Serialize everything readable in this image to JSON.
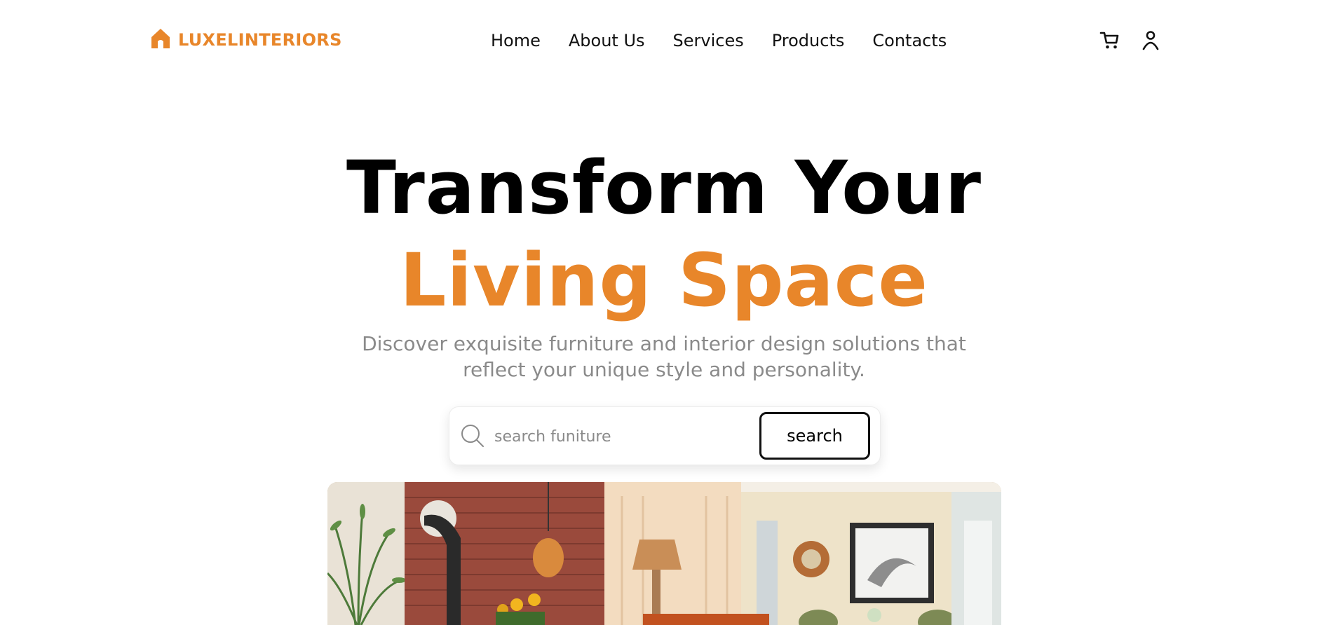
{
  "brand": {
    "name": "LUXELINTERIORS",
    "icon": "house-icon",
    "color": "#e8862a"
  },
  "nav": {
    "items": [
      {
        "label": "Home"
      },
      {
        "label": "About Us"
      },
      {
        "label": "Services"
      },
      {
        "label": "Products"
      },
      {
        "label": "Contacts"
      }
    ],
    "icons": [
      "cart-icon",
      "user-icon"
    ]
  },
  "hero": {
    "title_line1": "Transform Your",
    "title_line2": "Living Space",
    "subtitle": "Discover exquisite furniture and interior design solutions that reflect your unique style and personality."
  },
  "search": {
    "placeholder": "search funiture",
    "value": "",
    "button_label": "search",
    "icon": "search-icon"
  },
  "hero_image": {
    "subject": "living-room-photo"
  }
}
